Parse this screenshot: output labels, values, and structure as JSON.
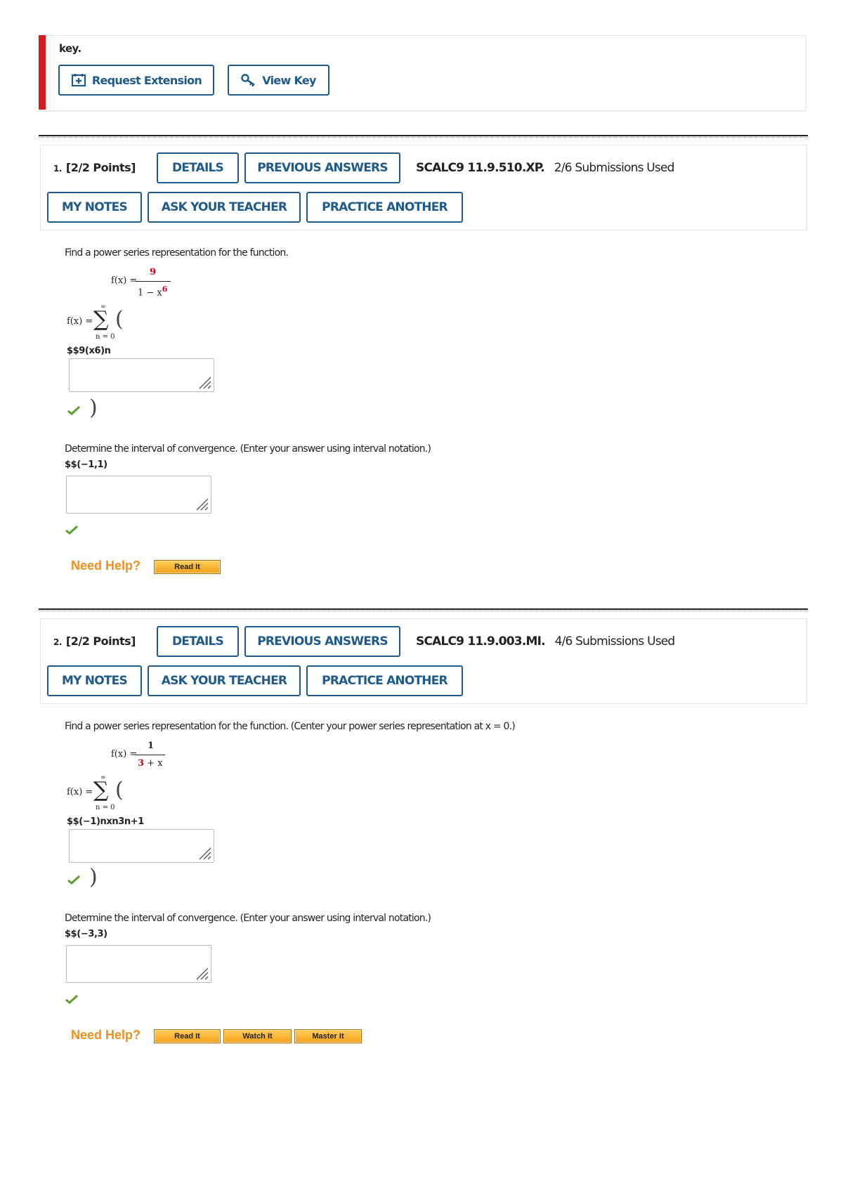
{
  "alert": {
    "text": "key.",
    "request_extension_label": "Request Extension",
    "view_key_label": "View Key"
  },
  "questions": [
    {
      "number": "1.",
      "points": "[2/2 Points]",
      "details_label": "DETAILS",
      "previous_answers_label": "PREVIOUS ANSWERS",
      "code": "SCALC9 11.9.510.XP.",
      "submissions": "2/6 Submissions Used",
      "my_notes_label": "MY NOTES",
      "ask_teacher_label": "ASK YOUR TEACHER",
      "practice_another_label": "PRACTICE ANOTHER",
      "prompt": "Find a power series representation for the function.",
      "func_lhs": "f(x) =",
      "func_num": "9",
      "func_den": "1 − x",
      "func_den_exp": "6",
      "series_lhs": "f(x) =",
      "sigma_top": "∞",
      "sigma_bottom": "n = 0",
      "series_answer": "$$9(x6)n",
      "interval_prompt": "Determine the interval of convergence. (Enter your answer using interval notation.)",
      "interval_answer": "$$(−1,1)",
      "need_help": "Need Help?",
      "help_buttons": [
        "Read It"
      ]
    },
    {
      "number": "2.",
      "points": "[2/2 Points]",
      "details_label": "DETAILS",
      "previous_answers_label": "PREVIOUS ANSWERS",
      "code": "SCALC9 11.9.003.MI.",
      "submissions": "4/6 Submissions Used",
      "my_notes_label": "MY NOTES",
      "ask_teacher_label": "ASK YOUR TEACHER",
      "practice_another_label": "PRACTICE ANOTHER",
      "prompt": "Find a power series representation for the function. (Center your power series representation at x = 0.)",
      "func_lhs": "f(x) =",
      "func_num": "1",
      "func_den_red": "3",
      "func_den_rest": " + x",
      "series_lhs": "f(x) =",
      "sigma_top": "∞",
      "sigma_bottom": "n = 0",
      "series_answer": "$$(−1)nxn3n+1",
      "interval_prompt": "Determine the interval of convergence. (Enter your answer using interval notation.)",
      "interval_answer": "$$(−3,3)",
      "need_help": "Need Help?",
      "help_buttons": [
        "Read It",
        "Watch It",
        "Master It"
      ]
    }
  ],
  "colors": {
    "accent_blue": "#1f5a8a",
    "alert_red": "#d61c23",
    "correct_green": "#5aa02c",
    "help_orange": "#f28e1c",
    "highlight_red": "#d0021b"
  }
}
